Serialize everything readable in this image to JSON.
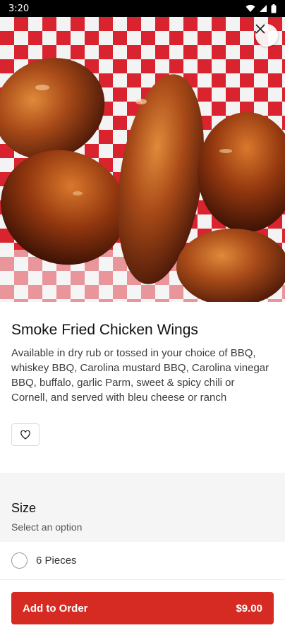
{
  "status_bar": {
    "time": "3:20",
    "icons": [
      "wifi-icon",
      "signal-icon",
      "battery-icon"
    ]
  },
  "hero": {
    "close_icon": "close-icon"
  },
  "item": {
    "title": "Smoke Fried Chicken Wings",
    "description": "Available in dry rub or tossed in your choice of BBQ, whiskey BBQ, Carolina mustard BBQ, Carolina vinegar BBQ, buffalo, garlic Parm, sweet & spicy chili or Cornell, and served with bleu cheese or ranch",
    "favorite_icon": "heart-icon"
  },
  "size": {
    "title": "Size",
    "subtitle": "Select an option",
    "options": [
      {
        "label": "6 Pieces",
        "selected": false
      }
    ]
  },
  "footer": {
    "add_label": "Add to Order",
    "price": "$9.00",
    "button_color": "#d62b22"
  }
}
